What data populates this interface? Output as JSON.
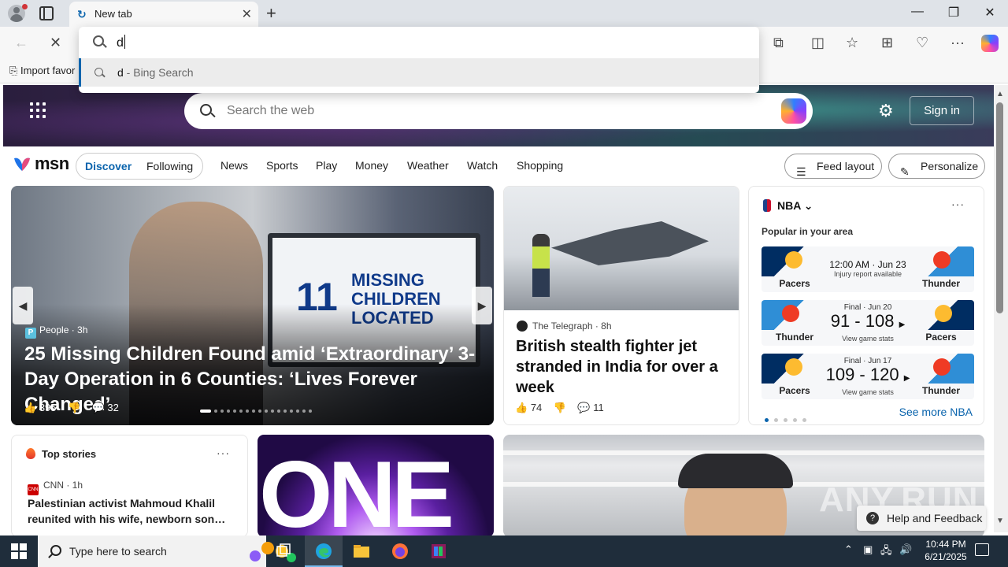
{
  "browser": {
    "tab_title": "New tab",
    "tab_favicon": "edge-loading-icon",
    "favorites_import": "Import favor",
    "window_controls": [
      "minimize",
      "restore",
      "close"
    ]
  },
  "omnibox": {
    "query": "d",
    "suggestion_query": "d",
    "suggestion_engine": " - Bing Search"
  },
  "msn": {
    "search_placeholder": "Search the web",
    "sign_in": "Sign in",
    "logo_text": "msn",
    "pill_tabs": [
      "Discover",
      "Following"
    ],
    "nav": [
      "News",
      "Sports",
      "Play",
      "Money",
      "Weather",
      "Watch",
      "Shopping"
    ],
    "feed_layout": "Feed layout",
    "personalize": "Personalize"
  },
  "main_story": {
    "tv_number": "11",
    "tv_text": "MISSING\nCHILDREN\nLOCATED",
    "source": "People",
    "age": "3h",
    "title": "25 Missing Children Found amid ‘Extraordinary’ 3-Day Operation in 6 Counties: ‘Lives Forever Changed’",
    "likes": "395",
    "comments": "32"
  },
  "jet_story": {
    "source": "The Telegraph",
    "age": "8h",
    "title": "British stealth fighter jet stranded in India for over a week",
    "likes": "74",
    "comments": "11"
  },
  "nba": {
    "title": "NBA",
    "popular": "Popular in your area",
    "games": [
      {
        "left": "Pacers",
        "right": "Thunder",
        "top": "12:00 AM · Jun 23",
        "score": "",
        "sub": "Injury report available"
      },
      {
        "left": "Thunder",
        "right": "Pacers",
        "top": "Final · Jun 20",
        "score": "91 - 108",
        "sub": "View game stats"
      },
      {
        "left": "Pacers",
        "right": "Thunder",
        "top": "Final · Jun 17",
        "score": "109 - 120",
        "sub": "View game stats"
      }
    ],
    "see_more": "See more NBA"
  },
  "top_stories": {
    "title": "Top stories",
    "source": "CNN",
    "age": "1h",
    "headline": "Palestinian activist Mahmoud Khalil reunited with his wife, newborn son…"
  },
  "one_card": {
    "text": "ONE"
  },
  "watermark": "ANY.RUN",
  "help": "Help and Feedback",
  "taskbar": {
    "search_placeholder": "Type here to search",
    "time": "10:44 PM",
    "date": "6/21/2025"
  },
  "colors": {
    "accent": "#0a64ad",
    "hero_dark": "#2a1e3d",
    "taskbar": "#1f2d3b"
  }
}
